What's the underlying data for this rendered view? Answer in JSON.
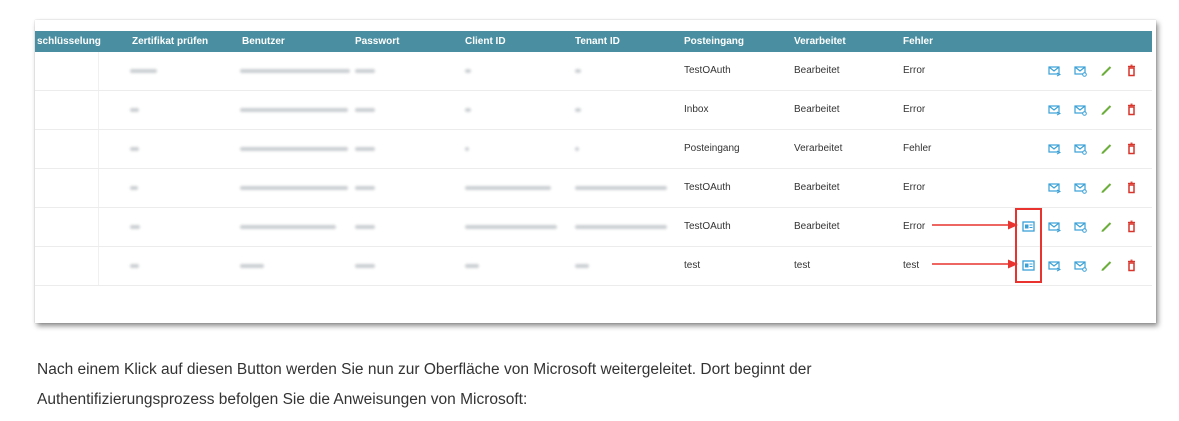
{
  "table": {
    "headers": [
      "schlüsselung",
      "Zertifikat prüfen",
      "Benutzer",
      "Passwort",
      "Client ID",
      "Tenant ID",
      "Posteingang",
      "Verarbeitet",
      "Fehler"
    ],
    "rows": [
      {
        "posteingang": "TestOAuth",
        "verarbeitet": "Bearbeitet",
        "fehler": "Error",
        "has_auth_button": false
      },
      {
        "posteingang": "Inbox",
        "verarbeitet": "Bearbeitet",
        "fehler": "Error",
        "has_auth_button": false
      },
      {
        "posteingang": "Posteingang",
        "verarbeitet": "Verarbeitet",
        "fehler": "Fehler",
        "has_auth_button": false
      },
      {
        "posteingang": "TestOAuth",
        "verarbeitet": "Bearbeitet",
        "fehler": "Error",
        "has_auth_button": false
      },
      {
        "posteingang": "TestOAuth",
        "verarbeitet": "Bearbeitet",
        "fehler": "Error",
        "has_auth_button": true
      },
      {
        "posteingang": "test",
        "verarbeitet": "test",
        "fehler": "test",
        "has_auth_button": true
      }
    ],
    "actions": [
      "auth-icon",
      "mail-send-icon",
      "mail-settings-icon",
      "edit-pencil-icon",
      "delete-trash-icon"
    ]
  },
  "colors": {
    "header_bg": "#4a8fa1",
    "action_blue": "#3aa0d8",
    "edit_green": "#6cae3b",
    "delete_red": "#d9342b",
    "annotation_red": "#e8332f"
  },
  "text": {
    "line1": "Nach einem Klick auf diesen Button werden Sie nun zur Oberfläche von Microsoft weitergeleitet. Dort beginnt der",
    "line2": "Authentifizierungsprozess befolgen Sie die Anweisungen von Microsoft:"
  }
}
